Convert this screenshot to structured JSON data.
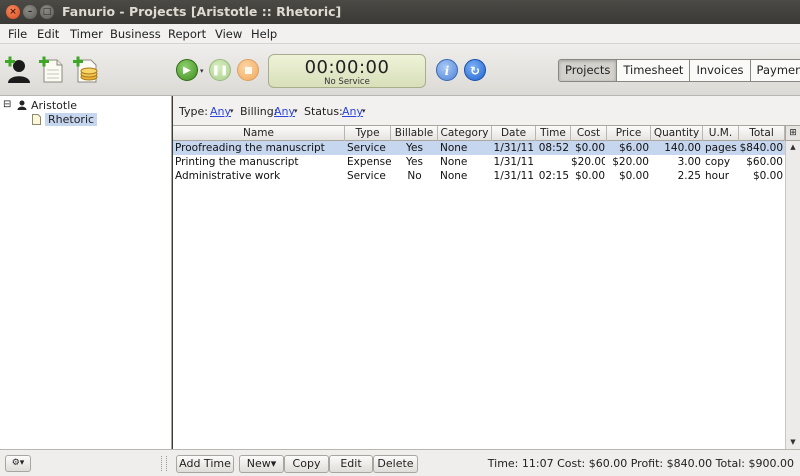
{
  "window": {
    "title": "Fanurio - Projects [Aristotle :: Rhetoric]",
    "close_glyph": "×",
    "min_glyph": "–",
    "max_glyph": "□"
  },
  "menu": [
    "File",
    "Edit",
    "Timer",
    "Business",
    "Report",
    "View",
    "Help"
  ],
  "toolbar": {
    "icons": [
      "add-client-icon",
      "add-project-icon",
      "add-business-icon"
    ],
    "play_glyph": "▶",
    "play_dropdown_glyph": "▾",
    "pause_glyph": "❚❚",
    "info_glyph": "i",
    "go_glyph": "↻",
    "timer_value": "00:00:00",
    "timer_subtitle": "No Service",
    "view_tabs": [
      "Projects",
      "Timesheet",
      "Invoices",
      "Payments"
    ],
    "active_tab": "Projects"
  },
  "tree": {
    "client": "Aristotle",
    "client_expander": "⊟",
    "project": "Rhetoric"
  },
  "filters": {
    "type_label": "Type:",
    "type_value": "Any",
    "billing_label": "Billing:",
    "billing_value": "Any",
    "status_label": "Status:",
    "status_value": "Any",
    "dropdown_glyph": "▾"
  },
  "table": {
    "columns": [
      "Name",
      "Type",
      "Billable",
      "Category",
      "Date",
      "Time",
      "Cost",
      "Price",
      "Quantity",
      "U.M.",
      "Total"
    ],
    "rows": [
      [
        "Proofreading the manuscript",
        "Service",
        "Yes",
        "None",
        "1/31/11",
        "08:52",
        "$0.00",
        "$6.00",
        "140.00",
        "pages",
        "$840.00"
      ],
      [
        "Printing the manuscript",
        "Expense",
        "Yes",
        "None",
        "1/31/11",
        "",
        "$20.00",
        "$20.00",
        "3.00",
        "copy",
        "$60.00"
      ],
      [
        "Administrative work",
        "Service",
        "No",
        "None",
        "1/31/11",
        "02:15",
        "$0.00",
        "$0.00",
        "2.25",
        "hour",
        "$0.00"
      ]
    ],
    "selected_row": 0,
    "corner_glyph": "⊞",
    "scroll_up_glyph": "▲",
    "scroll_down_glyph": "▼"
  },
  "statusbar": {
    "gear_glyph": "⚙▾",
    "buttons": {
      "add_time": "Add Time",
      "new": "New▾",
      "copy": "Copy",
      "edit": "Edit",
      "delete": "Delete"
    },
    "summary": "Time: 11:07 Cost: $60.00 Profit: $840.00 Total: $900.00"
  },
  "colors": {
    "selection": "#c6d6ef",
    "link": "#2b47d6",
    "play_green": "#3f8f1f",
    "accent_blue": "#1d62d1"
  }
}
